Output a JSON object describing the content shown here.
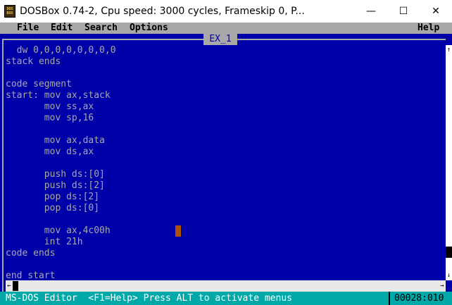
{
  "window": {
    "title": "DOSBox 0.74-2, Cpu speed:     3000 cycles, Frameskip  0, P...",
    "icon_text": [
      "DOS",
      "BOX"
    ],
    "minimize_label": "—",
    "maximize_label": "☐",
    "close_label": "✕"
  },
  "menu": {
    "file": "File",
    "edit": "Edit",
    "search": "Search",
    "options": "Options",
    "help": "Help"
  },
  "editor": {
    "file_title": "EX_1",
    "lines": [
      "  dw 0,0,0,0,0,0,0,0",
      "stack ends",
      "",
      "code segment",
      "start: mov ax,stack",
      "       mov ss,ax",
      "       mov sp,16",
      "",
      "       mov ax,data",
      "       mov ds,ax",
      "",
      "       push ds:[0]",
      "       push ds:[2]",
      "       pop ds:[2]",
      "       pop ds:[0]",
      "",
      "       mov ax,4c00h",
      "       int 21h",
      "code ends",
      "",
      "end start"
    ]
  },
  "scroll": {
    "up_arrow": "↑",
    "down_arrow": "↓",
    "left_arrow": "←",
    "right_arrow": "→"
  },
  "status": {
    "text": "MS-DOS Editor  <F1=Help> Press ALT to activate menus",
    "position": "00028:010"
  },
  "colors": {
    "dos_blue": "#0000a8",
    "dos_gray": "#a8a8a8",
    "status_cyan": "#00a8a8",
    "cursor": "#a85400"
  }
}
